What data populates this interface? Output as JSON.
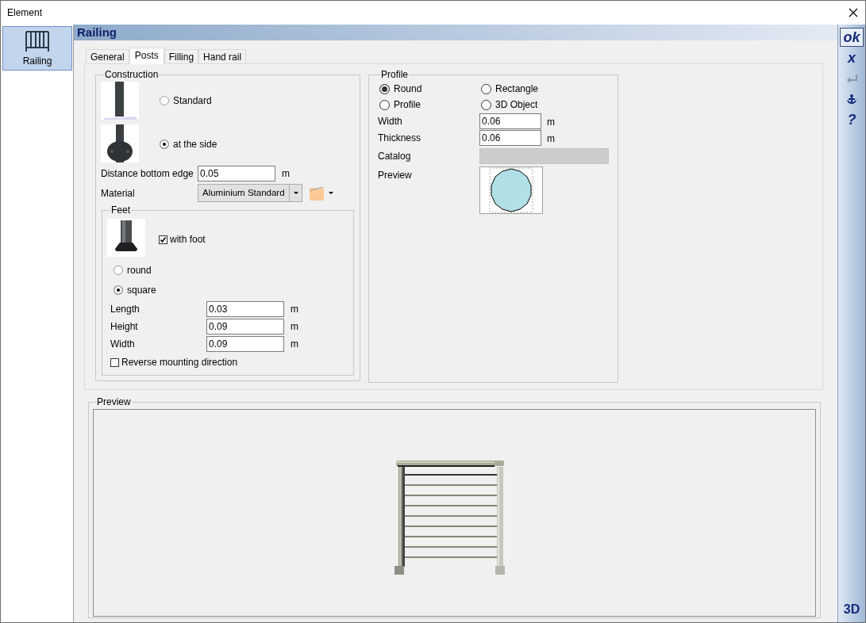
{
  "window": {
    "title": "Element"
  },
  "sidebar": {
    "items": [
      {
        "label": "Railing",
        "selected": true
      }
    ]
  },
  "header": "Railing",
  "tabs": [
    {
      "label": "General",
      "selected": false
    },
    {
      "label": "Posts",
      "selected": true
    },
    {
      "label": "Filling",
      "selected": false
    },
    {
      "label": "Hand rail",
      "selected": false
    }
  ],
  "construction": {
    "title": "Construction",
    "options": [
      {
        "label": "Standard",
        "selected": false
      },
      {
        "label": "at the side",
        "selected": true
      }
    ],
    "distance": {
      "label": "Distance bottom edge",
      "value": "0.05",
      "unit": "m"
    },
    "material": {
      "label": "Material",
      "value": "Aluminium Standard"
    }
  },
  "feet": {
    "title": "Feet",
    "with_foot": {
      "label": "with foot",
      "checked": true
    },
    "shapes": [
      {
        "label": "round",
        "selected": false
      },
      {
        "label": "square",
        "selected": true
      }
    ],
    "fields": [
      {
        "label": "Length",
        "value": "0.03",
        "unit": "m"
      },
      {
        "label": "Height",
        "value": "0.09",
        "unit": "m"
      },
      {
        "label": "Width",
        "value": "0.09",
        "unit": "m"
      }
    ],
    "reverse": {
      "label": "Reverse mounting direction",
      "checked": false
    }
  },
  "profile": {
    "title": "Profile",
    "options": [
      {
        "label": "Round",
        "selected": true
      },
      {
        "label": "Rectangle",
        "selected": false
      },
      {
        "label": "Profile",
        "selected": false
      },
      {
        "label": "3D Object",
        "selected": false
      }
    ],
    "fields": [
      {
        "label": "Width",
        "value": "0.06",
        "unit": "m"
      },
      {
        "label": "Thickness",
        "value": "0.06",
        "unit": "m"
      }
    ],
    "catalog_label": "Catalog",
    "preview_label": "Preview"
  },
  "preview": {
    "title": "Preview"
  },
  "toolbar": [
    {
      "kind": "text",
      "label": "ok",
      "selected": true,
      "disabled": false
    },
    {
      "kind": "text",
      "label": "x",
      "selected": false,
      "disabled": false
    },
    {
      "kind": "return",
      "selected": false,
      "disabled": true
    },
    {
      "kind": "anchor",
      "selected": false,
      "disabled": false
    },
    {
      "kind": "text",
      "label": "?",
      "selected": false,
      "disabled": false
    }
  ],
  "toolbar_bottom": "3D"
}
